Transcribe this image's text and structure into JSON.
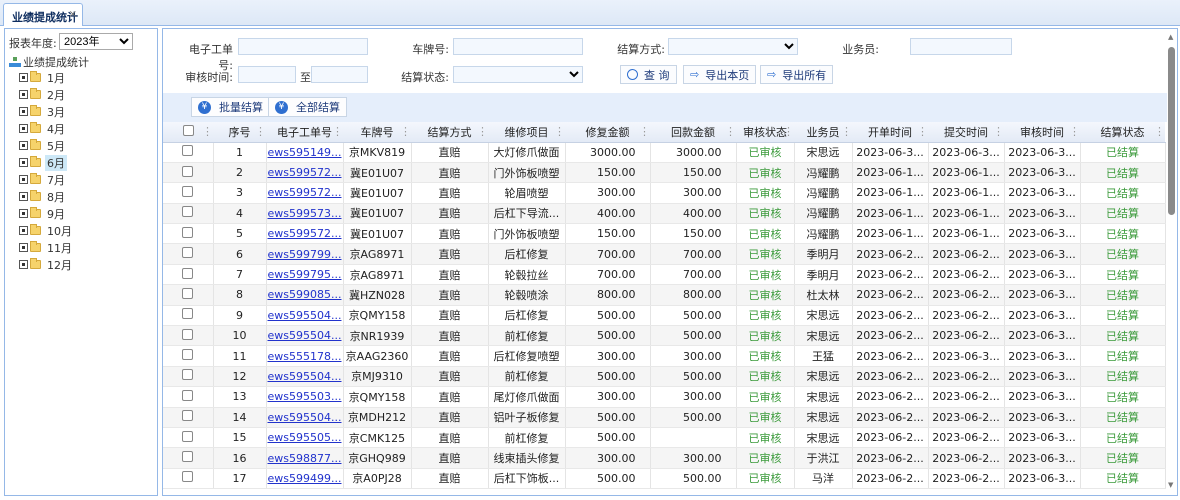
{
  "tabs": [
    {
      "label": "业绩提成统计",
      "close": "×"
    }
  ],
  "sidebar": {
    "year_label": "报表年度:",
    "year_value": "2023年",
    "root_label": "业绩提成统计",
    "months": [
      "1月",
      "2月",
      "3月",
      "4月",
      "5月",
      "6月",
      "7月",
      "8月",
      "9月",
      "10月",
      "11月",
      "12月"
    ],
    "selected": "6月"
  },
  "filters": {
    "order_no_label": "电子工单号:",
    "plate_label": "车牌号:",
    "settle_method_label": "结算方式:",
    "staff_label": "业务员:",
    "audit_time_label": "审核时间:",
    "to_label": "至",
    "settle_status_label": "结算状态:",
    "order_no_value": "",
    "plate_value": "",
    "staff_value": "",
    "audit_from": "",
    "audit_to": "",
    "settle_method_value": "",
    "settle_status_value": ""
  },
  "buttons": {
    "query": "查 询",
    "export_page": "导出本页",
    "export_all": "导出所有",
    "batch_settle": "批量结算",
    "settle_all": "全部结算"
  },
  "table": {
    "columns": [
      "",
      "序号",
      "电子工单号",
      "车牌号",
      "结算方式",
      "维修项目",
      "修复金额",
      "回款金额",
      "审核状态",
      "业务员",
      "开单时间",
      "提交时间",
      "审核时间",
      "结算状态"
    ],
    "rows": [
      [
        "1",
        "ews595149...",
        "京MKV819",
        "直赔",
        "大灯修爪做面",
        "3000.00",
        "3000.00",
        "已审核",
        "宋思远",
        "2023-06-3...",
        "2023-06-3...",
        "2023-06-3...",
        "已结算"
      ],
      [
        "2",
        "ews599572...",
        "冀E01U07",
        "直赔",
        "门外饰板喷塑",
        "150.00",
        "150.00",
        "已审核",
        "冯耀鹏",
        "2023-06-1...",
        "2023-06-1...",
        "2023-06-3...",
        "已结算"
      ],
      [
        "3",
        "ews599572...",
        "冀E01U07",
        "直赔",
        "轮眉喷塑",
        "300.00",
        "300.00",
        "已审核",
        "冯耀鹏",
        "2023-06-1...",
        "2023-06-1...",
        "2023-06-3...",
        "已结算"
      ],
      [
        "4",
        "ews599573...",
        "冀E01U07",
        "直赔",
        "后杠下导流...",
        "400.00",
        "400.00",
        "已审核",
        "冯耀鹏",
        "2023-06-1...",
        "2023-06-1...",
        "2023-06-3...",
        "已结算"
      ],
      [
        "5",
        "ews599572...",
        "冀E01U07",
        "直赔",
        "门外饰板喷塑",
        "150.00",
        "150.00",
        "已审核",
        "冯耀鹏",
        "2023-06-1...",
        "2023-06-1...",
        "2023-06-3...",
        "已结算"
      ],
      [
        "6",
        "ews599799...",
        "京AG8971",
        "直赔",
        "后杠修复",
        "700.00",
        "700.00",
        "已审核",
        "季明月",
        "2023-06-2...",
        "2023-06-2...",
        "2023-06-3...",
        "已结算"
      ],
      [
        "7",
        "ews599795...",
        "京AG8971",
        "直赔",
        "轮毂拉丝",
        "700.00",
        "700.00",
        "已审核",
        "季明月",
        "2023-06-2...",
        "2023-06-2...",
        "2023-06-3...",
        "已结算"
      ],
      [
        "8",
        "ews599085...",
        "冀HZN028",
        "直赔",
        "轮毂喷涂",
        "800.00",
        "800.00",
        "已审核",
        "杜太林",
        "2023-06-2...",
        "2023-06-2...",
        "2023-06-3...",
        "已结算"
      ],
      [
        "9",
        "ews595504...",
        "京QMY158",
        "直赔",
        "后杠修复",
        "500.00",
        "500.00",
        "已审核",
        "宋思远",
        "2023-06-2...",
        "2023-06-2...",
        "2023-06-3...",
        "已结算"
      ],
      [
        "10",
        "ews595504...",
        "京NR1939",
        "直赔",
        "前杠修复",
        "500.00",
        "500.00",
        "已审核",
        "宋思远",
        "2023-06-2...",
        "2023-06-2...",
        "2023-06-3...",
        "已结算"
      ],
      [
        "11",
        "ews555178...",
        "京AAG2360",
        "直赔",
        "后杠修复喷塑",
        "300.00",
        "300.00",
        "已审核",
        "王猛",
        "2023-06-2...",
        "2023-06-3...",
        "2023-06-3...",
        "已结算"
      ],
      [
        "12",
        "ews595504...",
        "京MJ9310",
        "直赔",
        "前杠修复",
        "500.00",
        "500.00",
        "已审核",
        "宋思远",
        "2023-06-2...",
        "2023-06-2...",
        "2023-06-3...",
        "已结算"
      ],
      [
        "13",
        "ews595503...",
        "京QMY158",
        "直赔",
        "尾灯修爪做面",
        "300.00",
        "300.00",
        "已审核",
        "宋思远",
        "2023-06-2...",
        "2023-06-2...",
        "2023-06-3...",
        "已结算"
      ],
      [
        "14",
        "ews595504...",
        "京MDH212",
        "直赔",
        "铝叶子板修复",
        "500.00",
        "500.00",
        "已审核",
        "宋思远",
        "2023-06-2...",
        "2023-06-2...",
        "2023-06-3...",
        "已结算"
      ],
      [
        "15",
        "ews595505...",
        "京CMK125",
        "直赔",
        "前杠修复",
        "500.00",
        "",
        "已审核",
        "宋思远",
        "2023-06-2...",
        "2023-06-2...",
        "2023-06-3...",
        "已结算"
      ],
      [
        "16",
        "ews598877...",
        "京GHQ989",
        "直赔",
        "线束插头修复",
        "300.00",
        "300.00",
        "已审核",
        "于洪江",
        "2023-06-2...",
        "2023-06-2...",
        "2023-06-3...",
        "已结算"
      ],
      [
        "17",
        "ews599499...",
        "京A0PJ28",
        "直赔",
        "后杠下饰板...",
        "500.00",
        "500.00",
        "已审核",
        "马洋",
        "2023-06-2...",
        "2023-06-2...",
        "2023-06-3...",
        "已结算"
      ]
    ]
  },
  "colors": {
    "accent": "#95b8e7",
    "status_green": "#3a9a3a",
    "link": "#2233cc"
  }
}
